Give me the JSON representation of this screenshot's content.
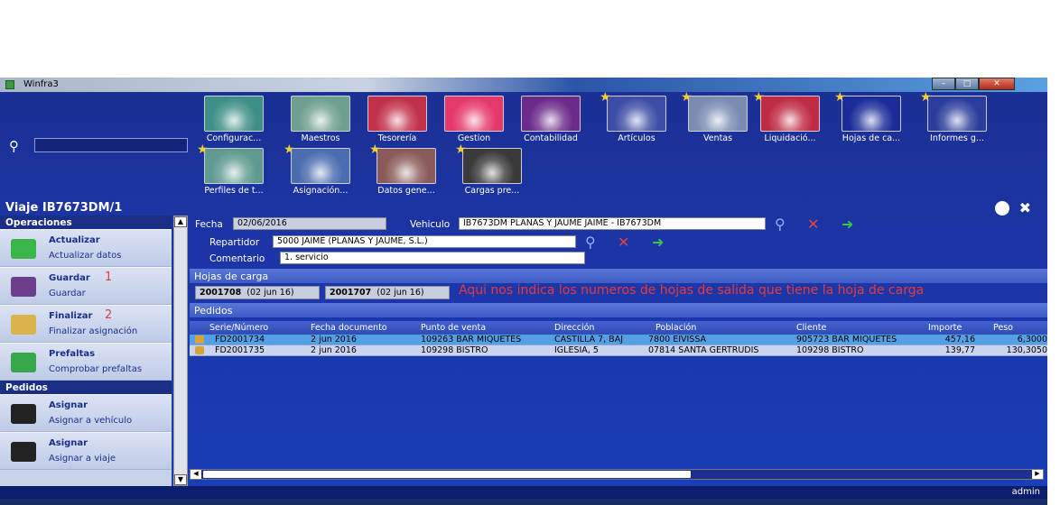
{
  "window": {
    "title": "Winfra3"
  },
  "toolbar": {
    "tiles": [
      {
        "label": "Configurac...",
        "star": false,
        "color": "#3e8f86"
      },
      {
        "label": "Maestros",
        "star": false,
        "color": "#6f9f8e"
      },
      {
        "label": "Tesorería",
        "star": false,
        "color": "#c2304a"
      },
      {
        "label": "Gestion",
        "star": false,
        "color": "#e7386b"
      },
      {
        "label": "Contabilidad",
        "star": false,
        "color": "#6c2a8a"
      },
      {
        "label": "Artículos",
        "star": true,
        "color": "#3e4ea6"
      },
      {
        "label": "Ventas",
        "star": true,
        "color": "#7b8cb3"
      },
      {
        "label": "Liquidació...",
        "star": true,
        "color": "#c02b44"
      },
      {
        "label": "Hojas de ca...",
        "star": true,
        "color": "#1b2c9a"
      },
      {
        "label": "Informes g...",
        "star": true,
        "color": "#2b3d9c"
      },
      {
        "label": "Perfiles de t...",
        "star": true,
        "color": "#5f9a90"
      },
      {
        "label": "Asignación...",
        "star": true,
        "color": "#4a6cb0"
      },
      {
        "label": "Datos gene...",
        "star": true,
        "color": "#8a5a5a"
      },
      {
        "label": "Cargas pre...",
        "star": true,
        "color": "#3a3a3a"
      }
    ]
  },
  "header": {
    "title": "Viaje IB7673DM/1"
  },
  "sidebar": {
    "sections": [
      {
        "label": "Operaciones"
      },
      {
        "label": "Pedidos"
      }
    ],
    "ops": [
      {
        "title": "Actualizar",
        "sub": "Actualizar datos",
        "num": "",
        "icon": "refresh-icon",
        "color": "#3ab54a"
      },
      {
        "title": "Guardar",
        "sub": "Guardar",
        "num": "1",
        "icon": "save-icon",
        "color": "#6b3f8e"
      },
      {
        "title": "Finalizar",
        "sub": "Finalizar asignación",
        "num": "2",
        "icon": "finish-icon",
        "color": "#d9b44a"
      },
      {
        "title": "Prefaltas",
        "sub": "Comprobar prefaltas",
        "num": "",
        "icon": "check-icon",
        "color": "#36a74a"
      },
      {
        "title": "Asignar",
        "sub": "Asignar a vehículo",
        "num": "",
        "icon": "truck-icon",
        "color": "#222"
      },
      {
        "title": "Asignar",
        "sub": "Asignar a viaje",
        "num": "",
        "icon": "truck-icon",
        "color": "#222"
      }
    ]
  },
  "form": {
    "fecha_label": "Fecha",
    "fecha_value": "02/06/2016",
    "vehiculo_label": "Vehiculo",
    "vehiculo_value": "IB7673DM PLANAS Y JAUME JAIME - IB7673DM",
    "repartidor_label": "Repartidor",
    "repartidor_value": "5000 JAIME (PLANAS Y JAUME, S.L.)",
    "comentario_label": "Comentario",
    "comentario_value": "1. servicio"
  },
  "hojas": {
    "title": "Hojas de carga",
    "items": [
      {
        "num": "2001708",
        "date": "(02 jun 16)"
      },
      {
        "num": "2001707",
        "date": "(02 jun 16)"
      }
    ],
    "note": "Aqui nos indica los numeros de hojas de salida que tiene la hoja de carga"
  },
  "pedidos": {
    "title": "Pedidos",
    "columns": [
      "Serie/Número",
      "Fecha documento",
      "Punto de venta",
      "Dirección",
      "Población",
      "Cliente",
      "Importe",
      "Peso"
    ],
    "rows": [
      [
        "FD2001734",
        "2 jun 2016",
        "109263 BAR MIQUETES",
        "CASTILLA 7, BAJ",
        "7800 EIVISSA",
        "905723 BAR MIQUETES",
        "457,16",
        "6,3000"
      ],
      [
        "FD2001735",
        "2 jun 2016",
        "109298 BISTRO",
        "IGLESIA, 5",
        "07814 SANTA GERTRUDIS",
        "109298 BISTRO",
        "139,77",
        "130,3050"
      ]
    ]
  },
  "status": {
    "user": "admin"
  }
}
